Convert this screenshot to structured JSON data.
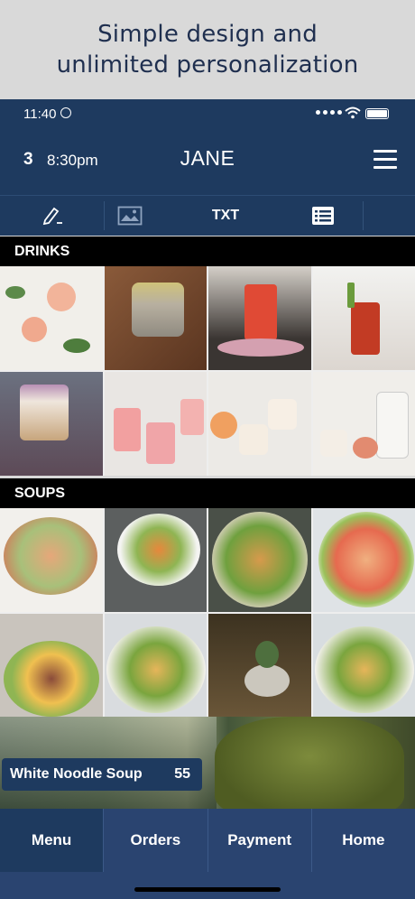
{
  "promo": {
    "line1": "Simple design and",
    "line2": "unlimited personalization"
  },
  "status_bar": {
    "time": "11:40"
  },
  "header": {
    "table_number": "3",
    "order_time": "8:30pm",
    "guest_name": "JANE"
  },
  "toolbar": {
    "edit_icon": "pencil-icon",
    "image_icon": "image-icon",
    "text_label": "TXT",
    "list_icon": "list-icon"
  },
  "sections": [
    {
      "title": "DRINKS"
    },
    {
      "title": "SOUPS"
    }
  ],
  "featured_item": {
    "name": "White Noodle Soup",
    "price": "55"
  },
  "bottom_nav": {
    "items": [
      "Menu",
      "Orders",
      "Payment",
      "Home"
    ],
    "active": "Menu"
  },
  "colors": {
    "navy": "#1e3a5f",
    "nav_bar": "#2a4470",
    "promo_bg": "#d9d9d9",
    "section_bar": "#000000"
  }
}
